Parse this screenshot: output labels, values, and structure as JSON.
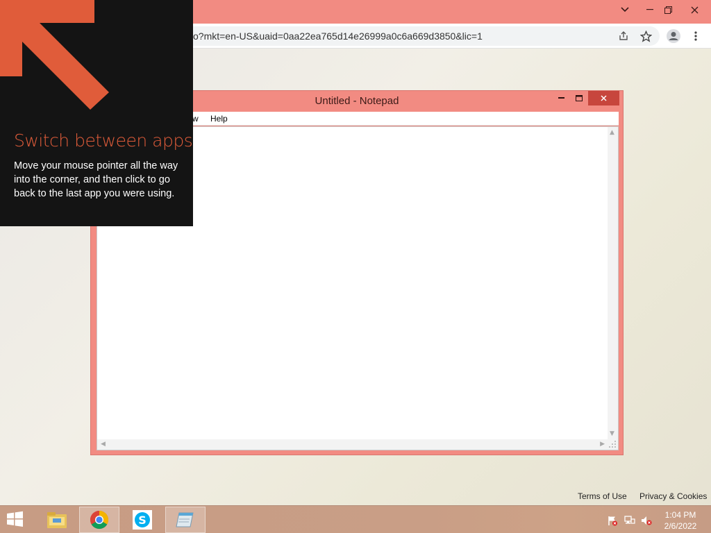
{
  "browser": {
    "url_text": "o?mkt=en-US&uaid=0aa22ea765d14e26999a0c6a669d3850&lic=1",
    "colors": {
      "titlebar": "#f28b82",
      "toolbar": "#ffffff"
    },
    "controls": {
      "tab_search_icon": "chevron-down-icon",
      "minimize_icon": "minimize-icon",
      "restore_icon": "restore-icon",
      "close_icon": "close-icon"
    },
    "toolbar_icons": [
      "share-icon",
      "star-icon",
      "profile-icon",
      "kebab-menu-icon"
    ]
  },
  "notepad": {
    "title": "Untitled - Notepad",
    "menu": {
      "view_fragment": "w",
      "help": "Help"
    },
    "colors": {
      "frame": "#f28b82",
      "close": "#c7463d"
    }
  },
  "hint": {
    "title": "Switch between apps",
    "body": "Move your mouse pointer all the way into the corner, and then click to go back to the last app you were using.",
    "colors": {
      "title": "#e05c3a",
      "arrow": "#e05c3a",
      "background": "#141414"
    }
  },
  "footer": {
    "terms": "Terms of Use",
    "privacy": "Privacy & Cookies"
  },
  "taskbar": {
    "apps": [
      {
        "name": "File Explorer",
        "icon": "file-explorer-icon",
        "active": false
      },
      {
        "name": "Google Chrome",
        "icon": "chrome-icon",
        "active": true
      },
      {
        "name": "Skype",
        "icon": "skype-icon",
        "active": false
      },
      {
        "name": "Notepad",
        "icon": "notepad-icon",
        "active": true
      }
    ],
    "tray_icons": [
      "action-center-flag-icon",
      "network-icon",
      "volume-muted-icon"
    ],
    "clock": {
      "time": "1:04 PM",
      "date": "2/6/2022"
    }
  }
}
